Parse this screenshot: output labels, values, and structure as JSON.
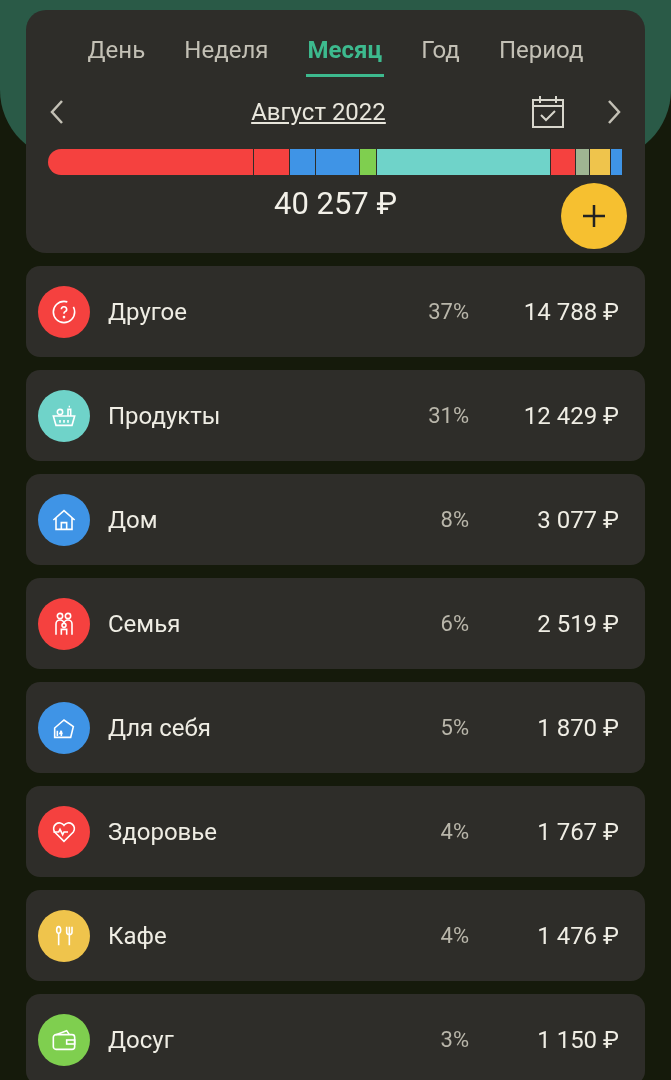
{
  "tabs": [
    {
      "label": "День",
      "selected": false
    },
    {
      "label": "Неделя",
      "selected": false
    },
    {
      "label": "Месяц",
      "selected": true
    },
    {
      "label": "Год",
      "selected": false
    },
    {
      "label": "Период",
      "selected": false
    }
  ],
  "period": "Август 2022",
  "segments": [
    {
      "color": "#f5413f"
    },
    {
      "color": "#f5413f"
    },
    {
      "color": "#3f94e6"
    },
    {
      "color": "#3f94e6"
    },
    {
      "color": "#7fcf4f"
    },
    {
      "color": "#6fd3c9"
    },
    {
      "color": "#f5413f"
    },
    {
      "color": "#9fb592"
    },
    {
      "color": "#efc44c"
    },
    {
      "color": "#3f94e6"
    }
  ],
  "total": "40 257 ₽",
  "categories": [
    {
      "name": "Другое",
      "percent": "37%",
      "amount": "14 788 ₽",
      "color": "#f5413f"
    },
    {
      "name": "Продукты",
      "percent": "31%",
      "amount": "12 429 ₽",
      "color": "#6fd3c9"
    },
    {
      "name": "Дом",
      "percent": "8%",
      "amount": "3 077 ₽",
      "color": "#3f94e6"
    },
    {
      "name": "Семья",
      "percent": "6%",
      "amount": "2 519 ₽",
      "color": "#f5413f"
    },
    {
      "name": "Для себя",
      "percent": "5%",
      "amount": "1 870 ₽",
      "color": "#3f94e6"
    },
    {
      "name": "Здоровье",
      "percent": "4%",
      "amount": "1 767 ₽",
      "color": "#f5413f"
    },
    {
      "name": "Кафе",
      "percent": "4%",
      "amount": "1 476 ₽",
      "color": "#efc44c"
    },
    {
      "name": "Досуг",
      "percent": "3%",
      "amount": "1 150 ₽",
      "color": "#7fcf4f"
    }
  ]
}
